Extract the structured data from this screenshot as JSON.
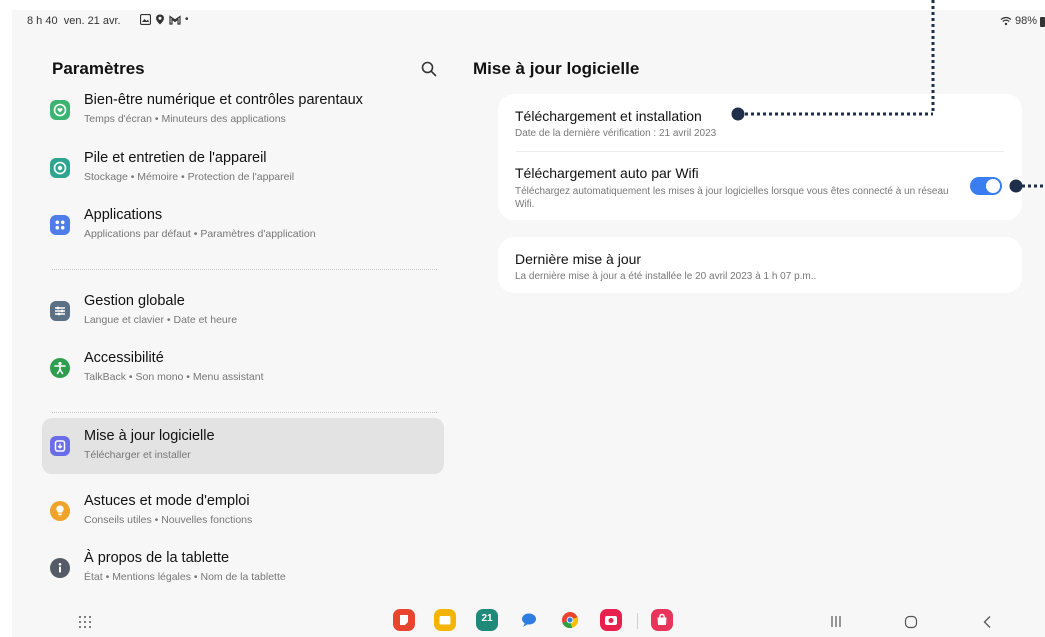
{
  "status_bar": {
    "time": "8 h 40",
    "date": "ven. 21 avr.",
    "battery": "98%"
  },
  "left_pane": {
    "title": "Paramètres",
    "items": [
      {
        "title": "Bien-être numérique et contrôles parentaux",
        "subtitle": "Temps d'écran  •  Minuteurs des applications",
        "icon": "wellbeing-icon",
        "color": "#3cb371"
      },
      {
        "title": "Pile et entretien de l'appareil",
        "subtitle": "Stockage  •  Mémoire  •  Protection de l'appareil",
        "icon": "device-care-icon",
        "color": "#2ea68f"
      },
      {
        "title": "Applications",
        "subtitle": "Applications par défaut  •  Paramètres d'application",
        "icon": "apps-icon",
        "color": "#4f7de8"
      },
      {
        "title": "Gestion globale",
        "subtitle": "Langue et clavier  •  Date et heure",
        "icon": "general-management-icon",
        "color": "#5b6f85"
      },
      {
        "title": "Accessibilité",
        "subtitle": "TalkBack  •  Son mono  •  Menu assistant",
        "icon": "accessibility-icon",
        "color": "#2e9d4e"
      },
      {
        "title": "Mise à jour logicielle",
        "subtitle": "Télécharger et installer",
        "icon": "software-update-icon",
        "color": "#6a6de8"
      },
      {
        "title": "Astuces et mode d'emploi",
        "subtitle": "Conseils utiles  •  Nouvelles fonctions",
        "icon": "tips-icon",
        "color": "#f0a32a"
      },
      {
        "title": "À propos de la tablette",
        "subtitle": "État  •  Mentions légales  •  Nom de la tablette",
        "icon": "about-icon",
        "color": "#555b66"
      }
    ]
  },
  "right_pane": {
    "title": "Mise à jour logicielle",
    "download_install": {
      "title": "Téléchargement et installation",
      "subtitle": "Date de la dernière vérification : 21 avril 2023"
    },
    "auto_wifi": {
      "title": "Téléchargement auto par Wifi",
      "subtitle": "Téléchargez automatiquement les mises à jour logicielles lorsque vous êtes connecté à un réseau Wifi.",
      "enabled": true
    },
    "last_update": {
      "title": "Dernière mise à jour",
      "subtitle": "La dernière mise à jour a été installée le 20 avril 2023 à 1 h 07 p.m.."
    }
  },
  "dock": {
    "apps": [
      {
        "name": "notes-app-icon",
        "color": "#e8442e"
      },
      {
        "name": "my-files-app-icon",
        "color": "#f5b400"
      },
      {
        "name": "calendar-app-icon",
        "color": "#1f8a7a",
        "label": "21"
      },
      {
        "name": "messages-app-icon",
        "color": "#2f7de1"
      },
      {
        "name": "chrome-app-icon",
        "color": "#e8442e"
      },
      {
        "name": "camera-app-icon",
        "color": "#e8204e"
      },
      {
        "name": "galaxy-store-app-icon",
        "color": "#e8335a"
      }
    ]
  },
  "accent_color": "#3a7df0"
}
